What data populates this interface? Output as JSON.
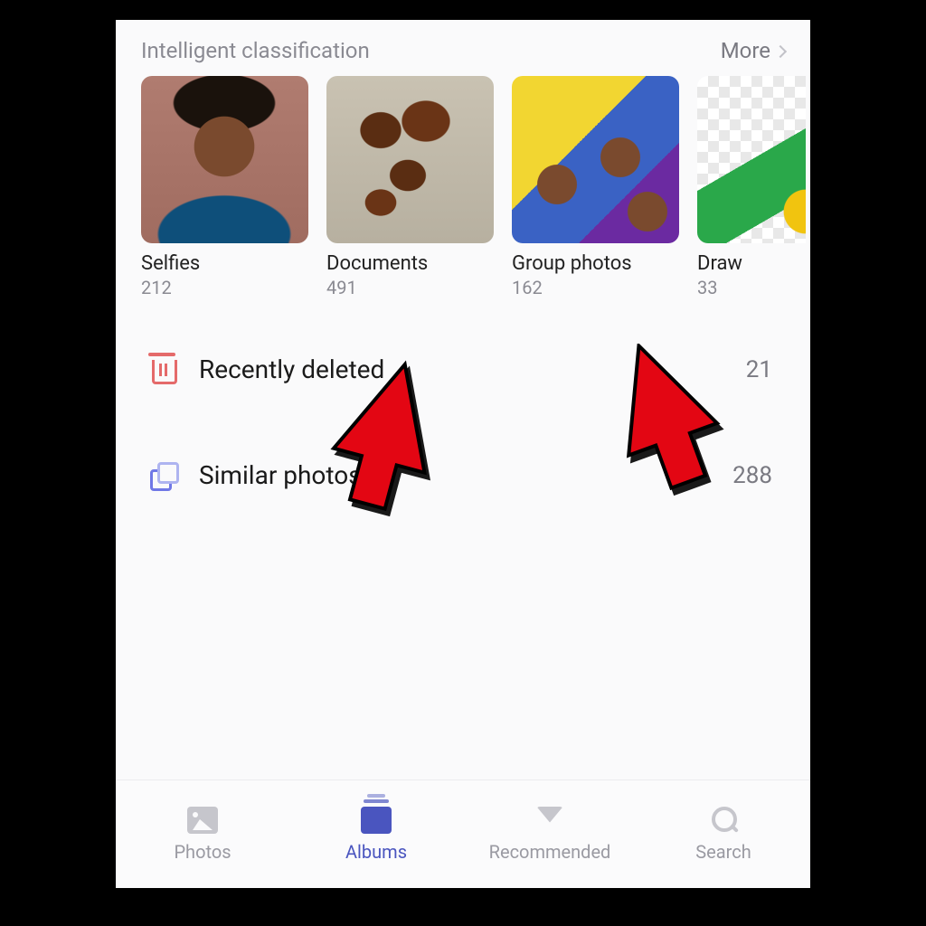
{
  "section": {
    "title": "Intelligent classification",
    "more_label": "More"
  },
  "albums": [
    {
      "label": "Selfies",
      "count": "212"
    },
    {
      "label": "Documents",
      "count": "491"
    },
    {
      "label": "Group photos",
      "count": "162"
    },
    {
      "label": "Draw",
      "count": "33"
    }
  ],
  "list": {
    "recently_deleted": {
      "label": "Recently deleted",
      "count": "21"
    },
    "similar_photos": {
      "label": "Similar photos",
      "count": "288"
    }
  },
  "nav": {
    "photos": "Photos",
    "albums": "Albums",
    "recommended": "Recommended",
    "search": "Search"
  }
}
